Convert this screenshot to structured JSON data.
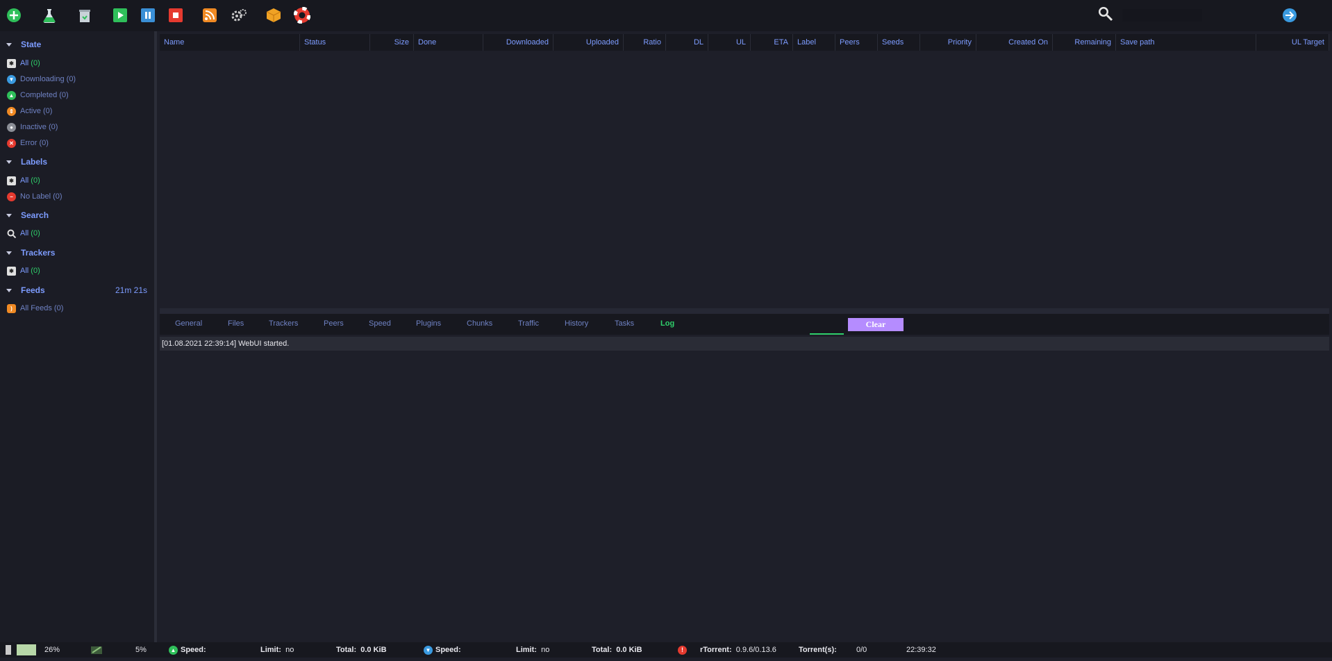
{
  "toolbar": {
    "icons": [
      "add-torrent-icon",
      "create-torrent-icon",
      "remove-icon",
      "start-icon",
      "pause-icon",
      "stop-icon",
      "rss-icon",
      "settings-icon",
      "plugins-icon",
      "help-icon"
    ],
    "search_placeholder": "",
    "colors": {
      "add": "#2fbf5a",
      "start": "#2fbf5a",
      "pause": "#3a8fd6",
      "stop": "#e53a2f",
      "rss": "#f08a24",
      "go": "#3a9ae0"
    }
  },
  "sidebar": {
    "state": {
      "title": "State",
      "items": [
        {
          "icon": "all-icon",
          "label": "All",
          "count": "(0)"
        },
        {
          "icon": "downloading-icon",
          "label": "Downloading (0)"
        },
        {
          "icon": "completed-icon",
          "label": "Completed (0)"
        },
        {
          "icon": "active-icon",
          "label": "Active (0)"
        },
        {
          "icon": "inactive-icon",
          "label": "Inactive (0)"
        },
        {
          "icon": "error-icon",
          "label": "Error (0)"
        }
      ]
    },
    "labels": {
      "title": "Labels",
      "items": [
        {
          "icon": "all-icon",
          "label": "All",
          "count": "(0)"
        },
        {
          "icon": "no-label-icon",
          "label": "No Label (0)"
        }
      ]
    },
    "search": {
      "title": "Search",
      "items": [
        {
          "icon": "search-icon",
          "label": "All",
          "count": "(0)"
        }
      ]
    },
    "trackers": {
      "title": "Trackers",
      "items": [
        {
          "icon": "all-icon",
          "label": "All",
          "count": "(0)"
        }
      ]
    },
    "feeds": {
      "title": "Feeds",
      "timer": "21m 21s",
      "items": [
        {
          "icon": "rss-icon",
          "label": "All Feeds (0)"
        }
      ]
    }
  },
  "table": {
    "columns": [
      "Name",
      "Status",
      "Size",
      "Done",
      "Downloaded",
      "Uploaded",
      "Ratio",
      "DL",
      "UL",
      "ETA",
      "Label",
      "Peers",
      "Seeds",
      "Priority",
      "Created On",
      "Remaining",
      "Save path",
      "UL Target"
    ],
    "rows": []
  },
  "details": {
    "tabs": [
      "General",
      "Files",
      "Trackers",
      "Peers",
      "Speed",
      "Plugins",
      "Chunks",
      "Traffic",
      "History",
      "Tasks",
      "Log"
    ],
    "active_tab": "Log",
    "clear_label": "Clear",
    "log": [
      "[01.08.2021 22:39:14] WebUI started."
    ]
  },
  "status": {
    "cpu": "26%",
    "disk": "5%",
    "dl_speed_label": "Speed:",
    "dl_speed": "",
    "dl_limit_label": "Limit:",
    "dl_limit": "no",
    "dl_total_label": "Total:",
    "dl_total": "0.0 KiB",
    "ul_speed_label": "Speed:",
    "ul_speed": "",
    "ul_limit_label": "Limit:",
    "ul_limit": "no",
    "ul_total_label": "Total:",
    "ul_total": "0.0 KiB",
    "rtorrent_label": "rTorrent:",
    "rtorrent_version": "0.9.6/0.13.6",
    "torrents_label": "Torrent(s):",
    "torrents": "0/0",
    "time": "22:39:32"
  }
}
